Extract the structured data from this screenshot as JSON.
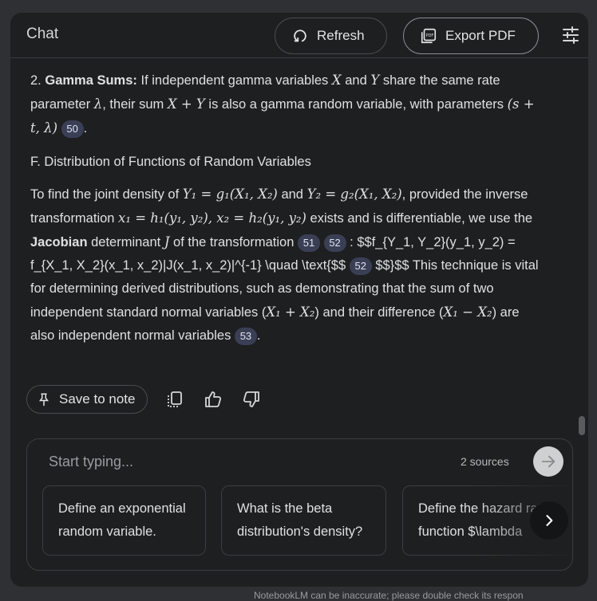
{
  "header": {
    "title": "Chat",
    "refresh_label": "Refresh",
    "export_label": "Export PDF"
  },
  "content": {
    "p1": {
      "prefix": "2. ",
      "bold": "Gamma Sums:",
      "t1": " If independent gamma variables ",
      "m1": "X",
      "t2": " and ",
      "m2": "Y",
      "t3": " share the same rate parameter ",
      "m3": "λ",
      "t4": ", their sum ",
      "m4": "X + Y",
      "t5": " is also a gamma random variable, with parameters ",
      "m5": "(s + t, λ)",
      "badge": "50",
      "end": "."
    },
    "section_heading": "F. Distribution of Functions of Random Variables",
    "p2": {
      "t1": "To find the joint density of ",
      "m1": "Y₁ = g₁(X₁, X₂)",
      "t2": " and ",
      "m2": "Y₂ = g₂(X₁, X₂)",
      "t3": ", provided the inverse transformation ",
      "m3": "x₁ = h₁(y₁, y₂), x₂ = h₂(y₁, y₂)",
      "t4": " exists and is differentiable, we use the ",
      "bold": "Jacobian",
      "t5": " determinant ",
      "m4": "J",
      "t6": " of the transformation ",
      "badge1": "51",
      "badge2": "52",
      "raw": ": $$f_{Y_1, Y_2}(y_1, y_2) = f_{X_1, X_2}(x_1, x_2)|J(x_1, x_2)|^{-1} \\quad \\text{$$ ",
      "badge3": "52",
      "t7": " $$}$$ This technique is vital for determining derived distributions, such as demonstrating that the sum of two independent standard normal variables (",
      "m5": "X₁ + X₂",
      "t8": ") and their difference (",
      "m6": "X₁ − X₂",
      "t9": ") are also independent normal variables ",
      "badge4": "53",
      "end": "."
    }
  },
  "actions": {
    "save_label": "Save to note",
    "icons": [
      "copy-icon",
      "thumbs-up-icon",
      "thumbs-down-icon"
    ]
  },
  "composer": {
    "placeholder": "Start typing...",
    "sources": "2 sources",
    "suggestions": [
      "Define an exponential random variable.",
      "What is the beta distribution's density?",
      "Define the hazard rate function $\\lambda"
    ]
  },
  "disclaimer": "NotebookLM can be inaccurate; please double check its respon",
  "colors": {
    "background": "#2f3033",
    "panel": "#1e1f21",
    "badge": "#3a3f55",
    "send_button": "#cfd0d2"
  }
}
